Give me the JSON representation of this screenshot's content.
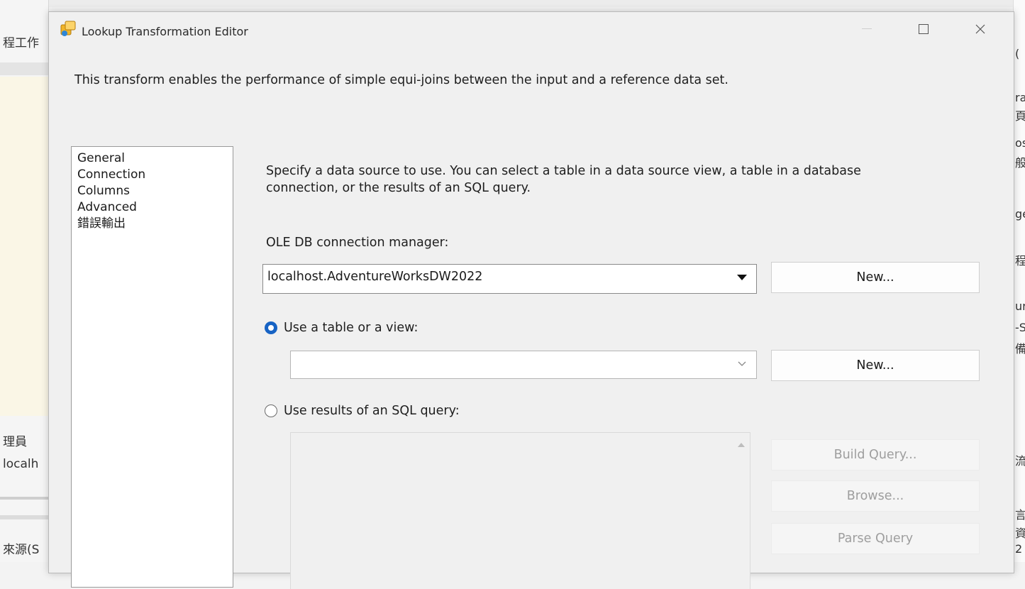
{
  "background": {
    "left_fragments": [
      "程工作",
      "理員",
      "localh",
      "來源(S"
    ],
    "right_fragments": [
      "(",
      "ra",
      "頁",
      "os",
      "般",
      "ge",
      "程",
      "ur",
      "-S",
      "備",
      "流",
      "言",
      "資",
      "2"
    ]
  },
  "dialog": {
    "title": "Lookup Transformation Editor",
    "description": "This transform enables the performance of simple equi-joins between the input and a reference data set."
  },
  "nav": {
    "items": [
      "General",
      "Connection",
      "Columns",
      "Advanced",
      "錯誤輸出"
    ]
  },
  "connection_page": {
    "instruction_line1": "Specify a data source to use. You can select a table in a data source view, a table in a database",
    "instruction_line2": "connection, or the results of an SQL query.",
    "conn_manager_label": "OLE DB connection manager:",
    "conn_manager_value": "localhost.AdventureWorksDW2022",
    "new_button_1": "New...",
    "use_table_label": "Use a table or a view:",
    "use_table_selected": true,
    "table_value": "",
    "new_button_2": "New...",
    "use_sql_label": "Use results of an SQL query:",
    "use_sql_selected": false,
    "build_query_button": "Build Query...",
    "browse_button": "Browse...",
    "parse_query_button": "Parse Query"
  },
  "colors": {
    "radio_accent": "#1763c4",
    "dialog_bg": "#f0f0f0"
  }
}
